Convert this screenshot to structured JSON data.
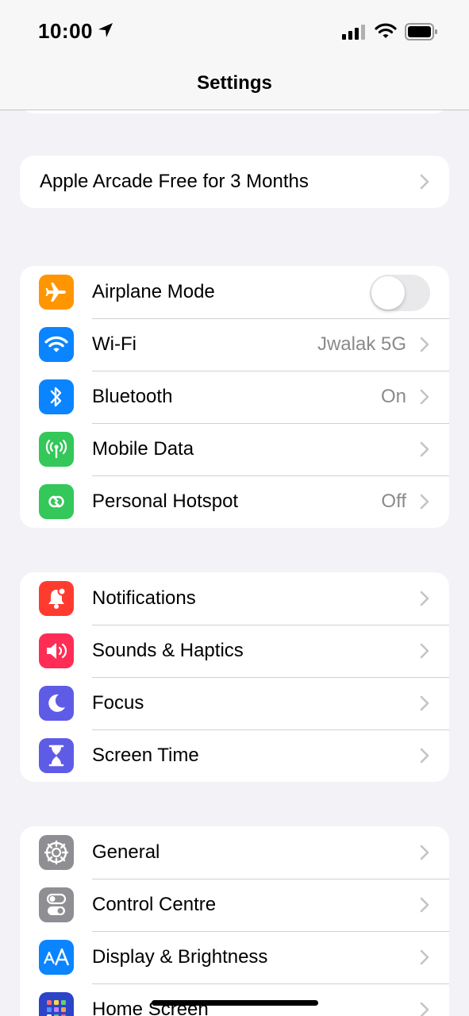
{
  "status_bar": {
    "time": "10:00",
    "icons": [
      "location-arrow-icon",
      "cellular-signal-icon",
      "wifi-icon",
      "battery-icon"
    ]
  },
  "nav": {
    "title": "Settings"
  },
  "promo": {
    "label": "Apple Arcade Free for 3 Months"
  },
  "connectivity": {
    "airplane": {
      "label": "Airplane Mode",
      "toggle_on": false,
      "icon": "airplane-icon",
      "color": "#FF9500"
    },
    "wifi": {
      "label": "Wi-Fi",
      "value": "Jwalak 5G",
      "icon": "wifi-icon",
      "color": "#0A84FF"
    },
    "bluetooth": {
      "label": "Bluetooth",
      "value": "On",
      "icon": "bluetooth-icon",
      "color": "#0A84FF"
    },
    "mobile_data": {
      "label": "Mobile Data",
      "icon": "antenna-icon",
      "color": "#34C759"
    },
    "hotspot": {
      "label": "Personal Hotspot",
      "value": "Off",
      "icon": "hotspot-icon",
      "color": "#34C759"
    }
  },
  "notifications_group": {
    "notifications": {
      "label": "Notifications",
      "icon": "bell-icon",
      "color": "#FF3B30"
    },
    "sounds": {
      "label": "Sounds & Haptics",
      "icon": "speaker-icon",
      "color": "#FF2D55"
    },
    "focus": {
      "label": "Focus",
      "icon": "moon-icon",
      "color": "#5E5CE6"
    },
    "screen_time": {
      "label": "Screen Time",
      "icon": "hourglass-icon",
      "color": "#5E5CE6"
    }
  },
  "general_group": {
    "general": {
      "label": "General",
      "icon": "gear-icon",
      "color": "#8E8E93"
    },
    "control_centre": {
      "label": "Control Centre",
      "icon": "switches-icon",
      "color": "#8E8E93"
    },
    "display": {
      "label": "Display & Brightness",
      "icon": "text-size-icon",
      "color": "#0A84FF"
    },
    "home_screen": {
      "label": "Home Screen",
      "icon": "app-grid-icon",
      "color": "#2C44C8"
    }
  }
}
